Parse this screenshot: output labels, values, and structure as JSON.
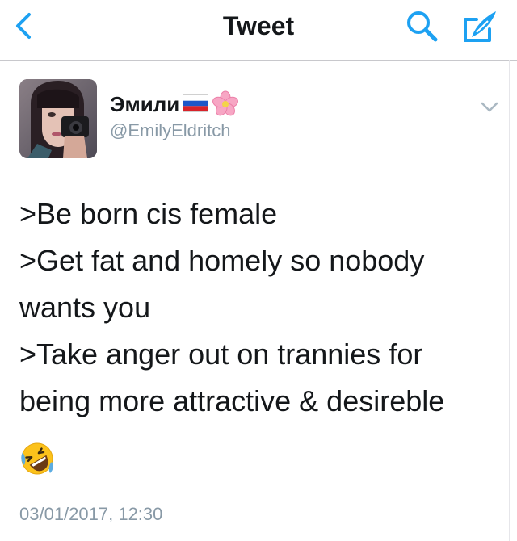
{
  "navbar": {
    "title": "Tweet",
    "back_icon": "chevron-left-icon",
    "search_icon": "search-icon",
    "compose_icon": "compose-icon",
    "accent_color": "#1da1f2"
  },
  "tweet": {
    "display_name": "Эмили",
    "name_emojis": [
      "russia-flag-icon",
      "cherry-blossom-icon"
    ],
    "username": "@EmilyEldritch",
    "lines": [
      ">Be born cis female",
      ">Get fat and homely so nobody",
      "wants you",
      ">Take anger out on trannies for",
      "being more attractive & desireble"
    ],
    "reaction_emoji": "rolling-on-floor-laughing-icon",
    "timestamp": "03/01/2017, 12:30"
  }
}
